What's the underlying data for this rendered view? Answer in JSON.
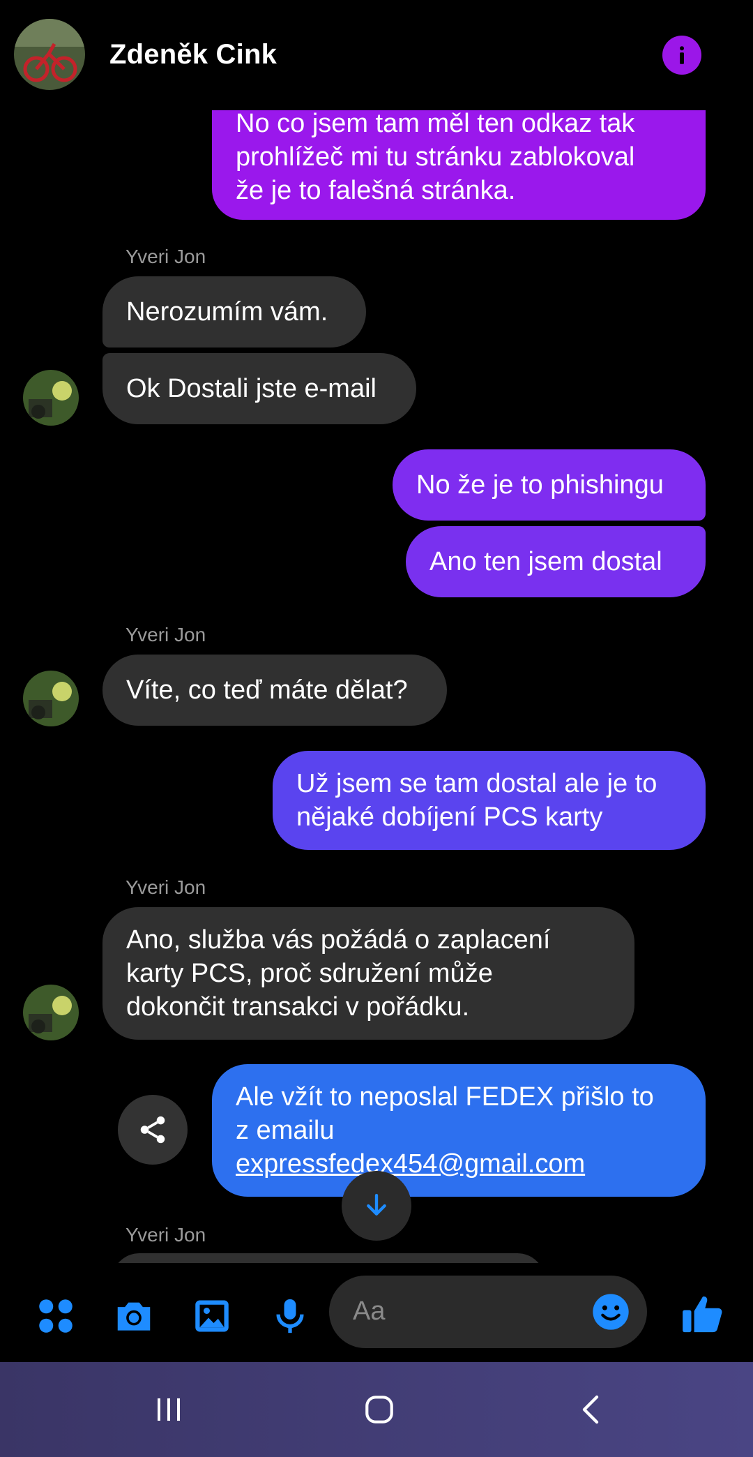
{
  "header": {
    "contact_name": "Zdeněk Cink"
  },
  "messages": [
    {
      "from": "me",
      "lines": [
        "No co jsem tam měl ten odkaz tak",
        "prohlížeč mi tu stránku zablokoval",
        "že je to falešná stránka."
      ]
    },
    {
      "sender": "Yveri Jon"
    },
    {
      "from": "them",
      "lines": [
        "Nerozumím vám."
      ]
    },
    {
      "from": "them",
      "lines": [
        "Ok Dostali jste e-mail"
      ]
    },
    {
      "from": "me",
      "lines": [
        "No že je to phishingu"
      ]
    },
    {
      "from": "me",
      "lines": [
        "Ano ten jsem dostal"
      ]
    },
    {
      "sender": "Yveri Jon"
    },
    {
      "from": "them",
      "lines": [
        "Víte, co teď máte dělat?"
      ]
    },
    {
      "from": "me",
      "lines": [
        "Už jsem se tam dostal ale je to",
        "nějaké dobíjení PCS karty"
      ]
    },
    {
      "sender": "Yveri Jon"
    },
    {
      "from": "them",
      "lines": [
        "Ano, služba vás požádá o zaplacení",
        "karty PCS, proč sdružení může",
        "dokončit transakci v pořádku."
      ]
    },
    {
      "from": "me",
      "lines": [
        "Ale vžít to neposlal FEDEX přišlo to",
        "z emailu"
      ],
      "link": "expressfedex454@gmail.com"
    },
    {
      "sender": "Yveri Jon"
    }
  ],
  "composer": {
    "placeholder": "Aa"
  },
  "colors": {
    "accent": "#0a7cff",
    "incoming": "#303030",
    "info": "#9b17e8"
  }
}
